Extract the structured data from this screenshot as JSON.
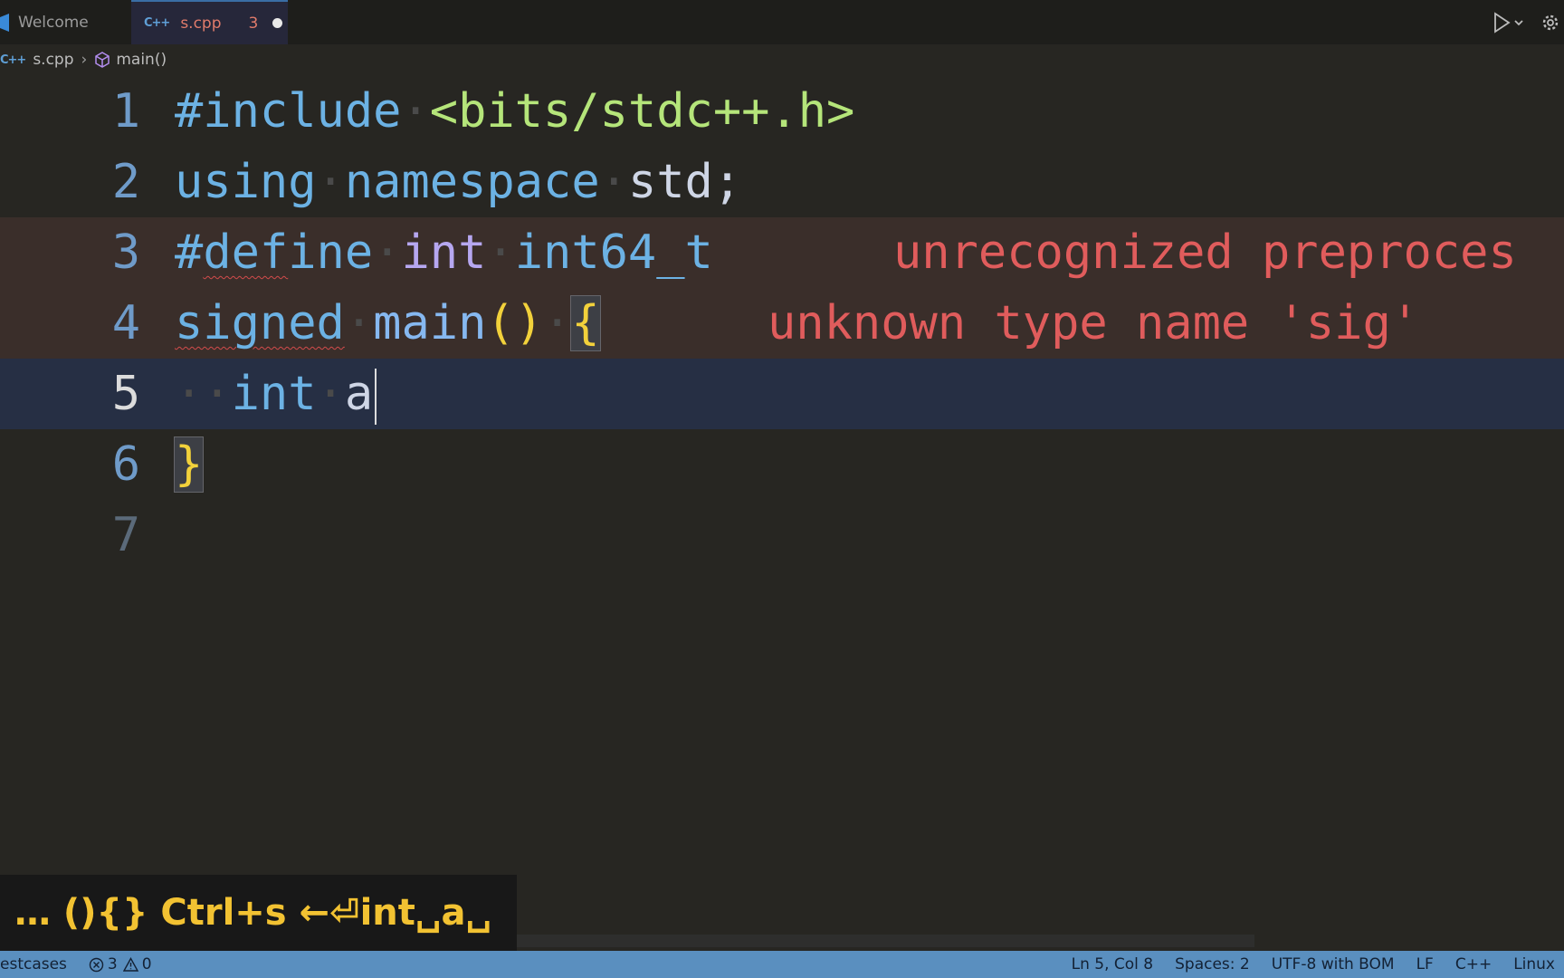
{
  "tabs": [
    {
      "label": "Welcome",
      "active": false
    },
    {
      "label": "s.cpp",
      "error_count": "3",
      "active": true,
      "dirty": true,
      "badge": "C++"
    }
  ],
  "breadcrumb": {
    "file": "s.cpp",
    "badge": "C++",
    "symbol": "main()"
  },
  "editor": {
    "line_numbers": [
      "1",
      "2",
      "3",
      "4",
      "5",
      "6",
      "7"
    ],
    "current_line": "5",
    "lines": {
      "l1": {
        "include": "#include",
        "header": "<bits/stdc++.h>"
      },
      "l2": {
        "using": "using",
        "namespace": "namespace",
        "std": "std",
        "semi": ";"
      },
      "l3": {
        "define": "#define",
        "int": "int",
        "int64": "int64_t"
      },
      "l4": {
        "signed": "signed",
        "main": "main",
        "parens": "()",
        "brace": "{"
      },
      "l5": {
        "int": "int",
        "a": "a"
      },
      "l6": {
        "brace": "}"
      }
    },
    "inline_errors": {
      "l3": "unrecognized preproces",
      "l4": "unknown type name 'sig'"
    }
  },
  "keystrokes": "… (){} Ctrl+s ←⏎int␣a␣",
  "statusbar": {
    "testcases": "estcases",
    "errors": "3",
    "warnings": "0",
    "position": "Ln 5, Col 8",
    "spaces": "Spaces: 2",
    "encoding": "UTF-8 with BOM",
    "eol": "LF",
    "language": "C++",
    "platform": "Linux"
  },
  "colors": {
    "editor_bg": "#272622",
    "status_bar": "#5a8fbf",
    "error_text": "#e05c5c",
    "keystroke_text": "#f2c232"
  }
}
